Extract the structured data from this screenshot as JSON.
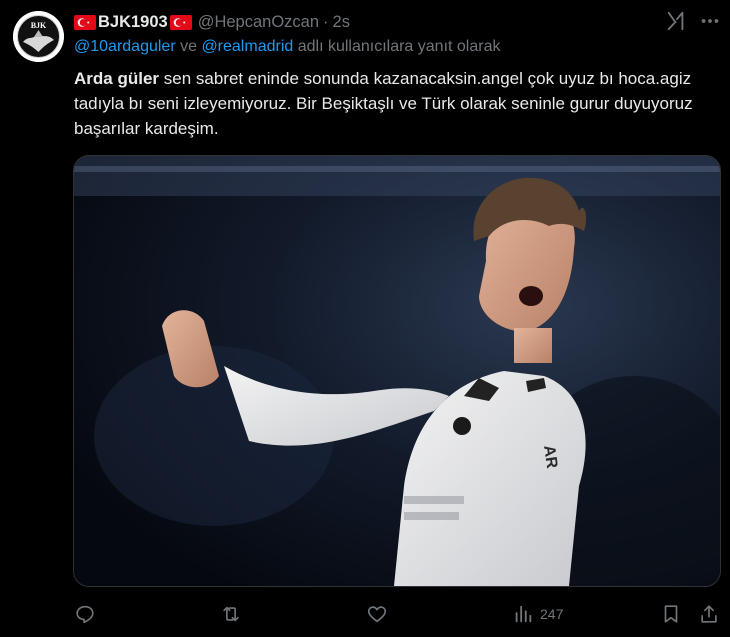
{
  "author": {
    "display_name": "BJK1903",
    "handle": "@HepcanOzcan",
    "separator": "·",
    "time": "2s",
    "avatar_text": "BJK"
  },
  "reply": {
    "mention1": "@10ardaguler",
    "joiner": " ve ",
    "mention2": "@realmadrid",
    "suffix": " adlı kullanıcılara yanıt olarak"
  },
  "body": {
    "bold": "Arda güler",
    "text": " sen sabret eninde sonunda kazanacaksin.angel çok uyuz bı hoca.agiz tadıyla bı seni izleyemiyoruz. Bir Beşiktaşlı ve Türk olarak seninle gurur duyuyoruz başarılar kardeşim."
  },
  "media": {
    "alt": "photo",
    "shirt_text": "AR"
  },
  "actions": {
    "views": "247"
  },
  "icons": {
    "grok": "grok-icon",
    "more": "more-icon",
    "reply": "reply-icon",
    "retweet": "retweet-icon",
    "like": "like-icon",
    "views": "views-icon",
    "bookmark": "bookmark-icon",
    "share": "share-icon"
  },
  "colors": {
    "background": "#000000",
    "text": "#e7e9ea",
    "muted": "#71767b",
    "link": "#1d9bf0",
    "flag_red": "#e30a17"
  }
}
